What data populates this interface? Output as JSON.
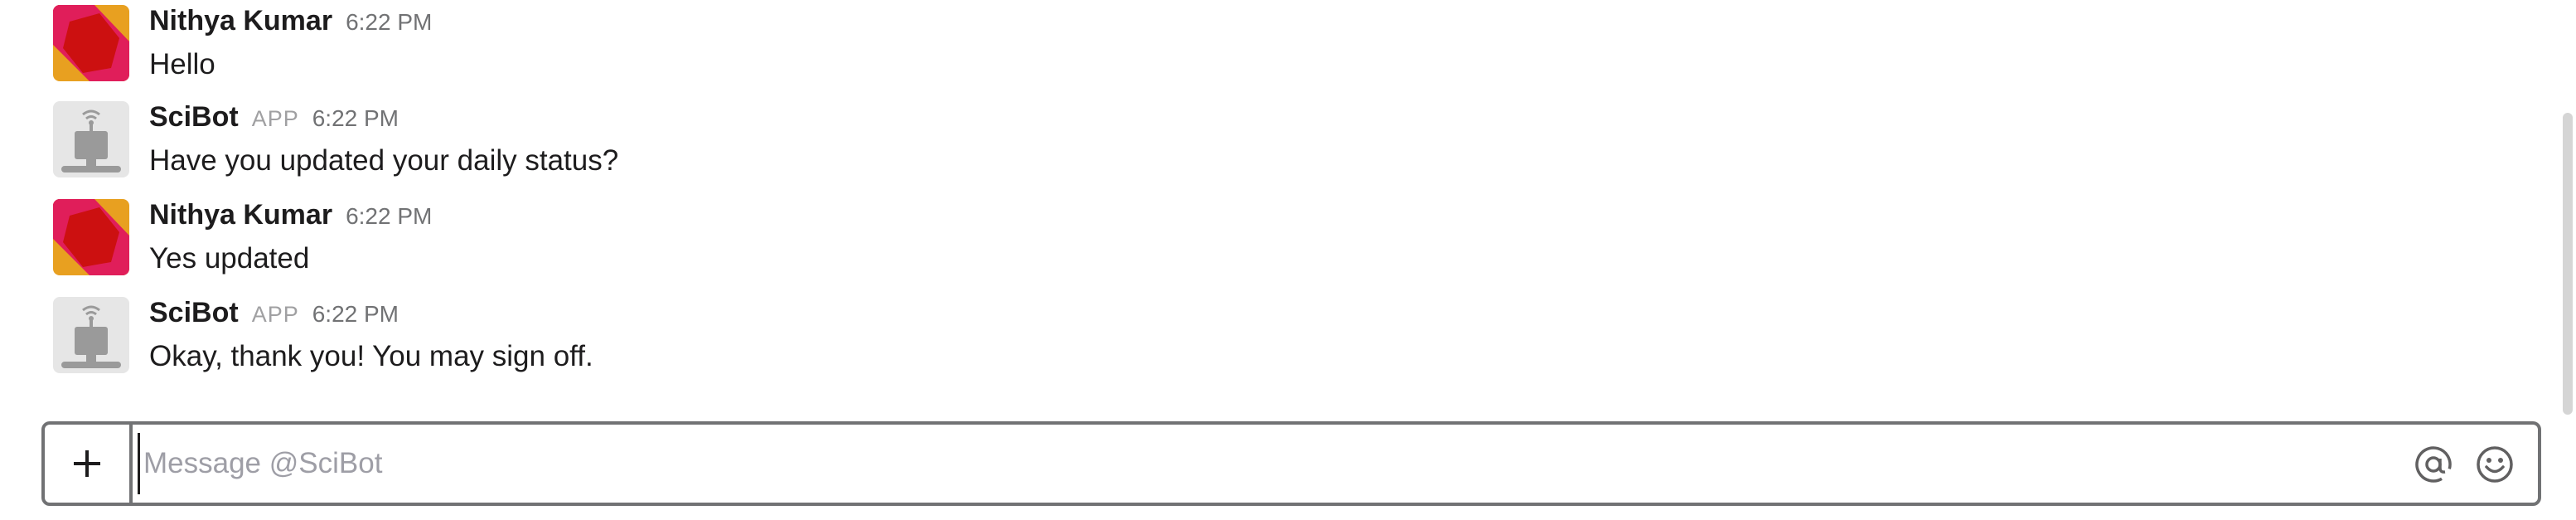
{
  "messages": [
    {
      "sender": "Nithya Kumar",
      "is_app": false,
      "app_badge": "",
      "time": "6:22 PM",
      "text": "Hello",
      "avatar": "nithya-avatar"
    },
    {
      "sender": "SciBot",
      "is_app": true,
      "app_badge": "APP",
      "time": "6:22 PM",
      "text": "Have you updated your daily status?",
      "avatar": "scibot-avatar"
    },
    {
      "sender": "Nithya Kumar",
      "is_app": false,
      "app_badge": "",
      "time": "6:22 PM",
      "text": "Yes updated",
      "avatar": "nithya-avatar"
    },
    {
      "sender": "SciBot",
      "is_app": true,
      "app_badge": "APP",
      "time": "6:22 PM",
      "text": "Okay, thank you! You may sign off.",
      "avatar": "scibot-avatar"
    }
  ],
  "composer": {
    "placeholder": "Message @SciBot",
    "value": "",
    "plus_icon": "plus-icon",
    "mention_icon": "at-sign-icon",
    "emoji_icon": "smiley-face-icon"
  },
  "colors": {
    "avatar_orange": "#e8a020",
    "avatar_pink": "#e01e5a",
    "avatar_red": "#cc1010",
    "composer_border": "#717274",
    "robot_gray": "#9a9a9a"
  }
}
